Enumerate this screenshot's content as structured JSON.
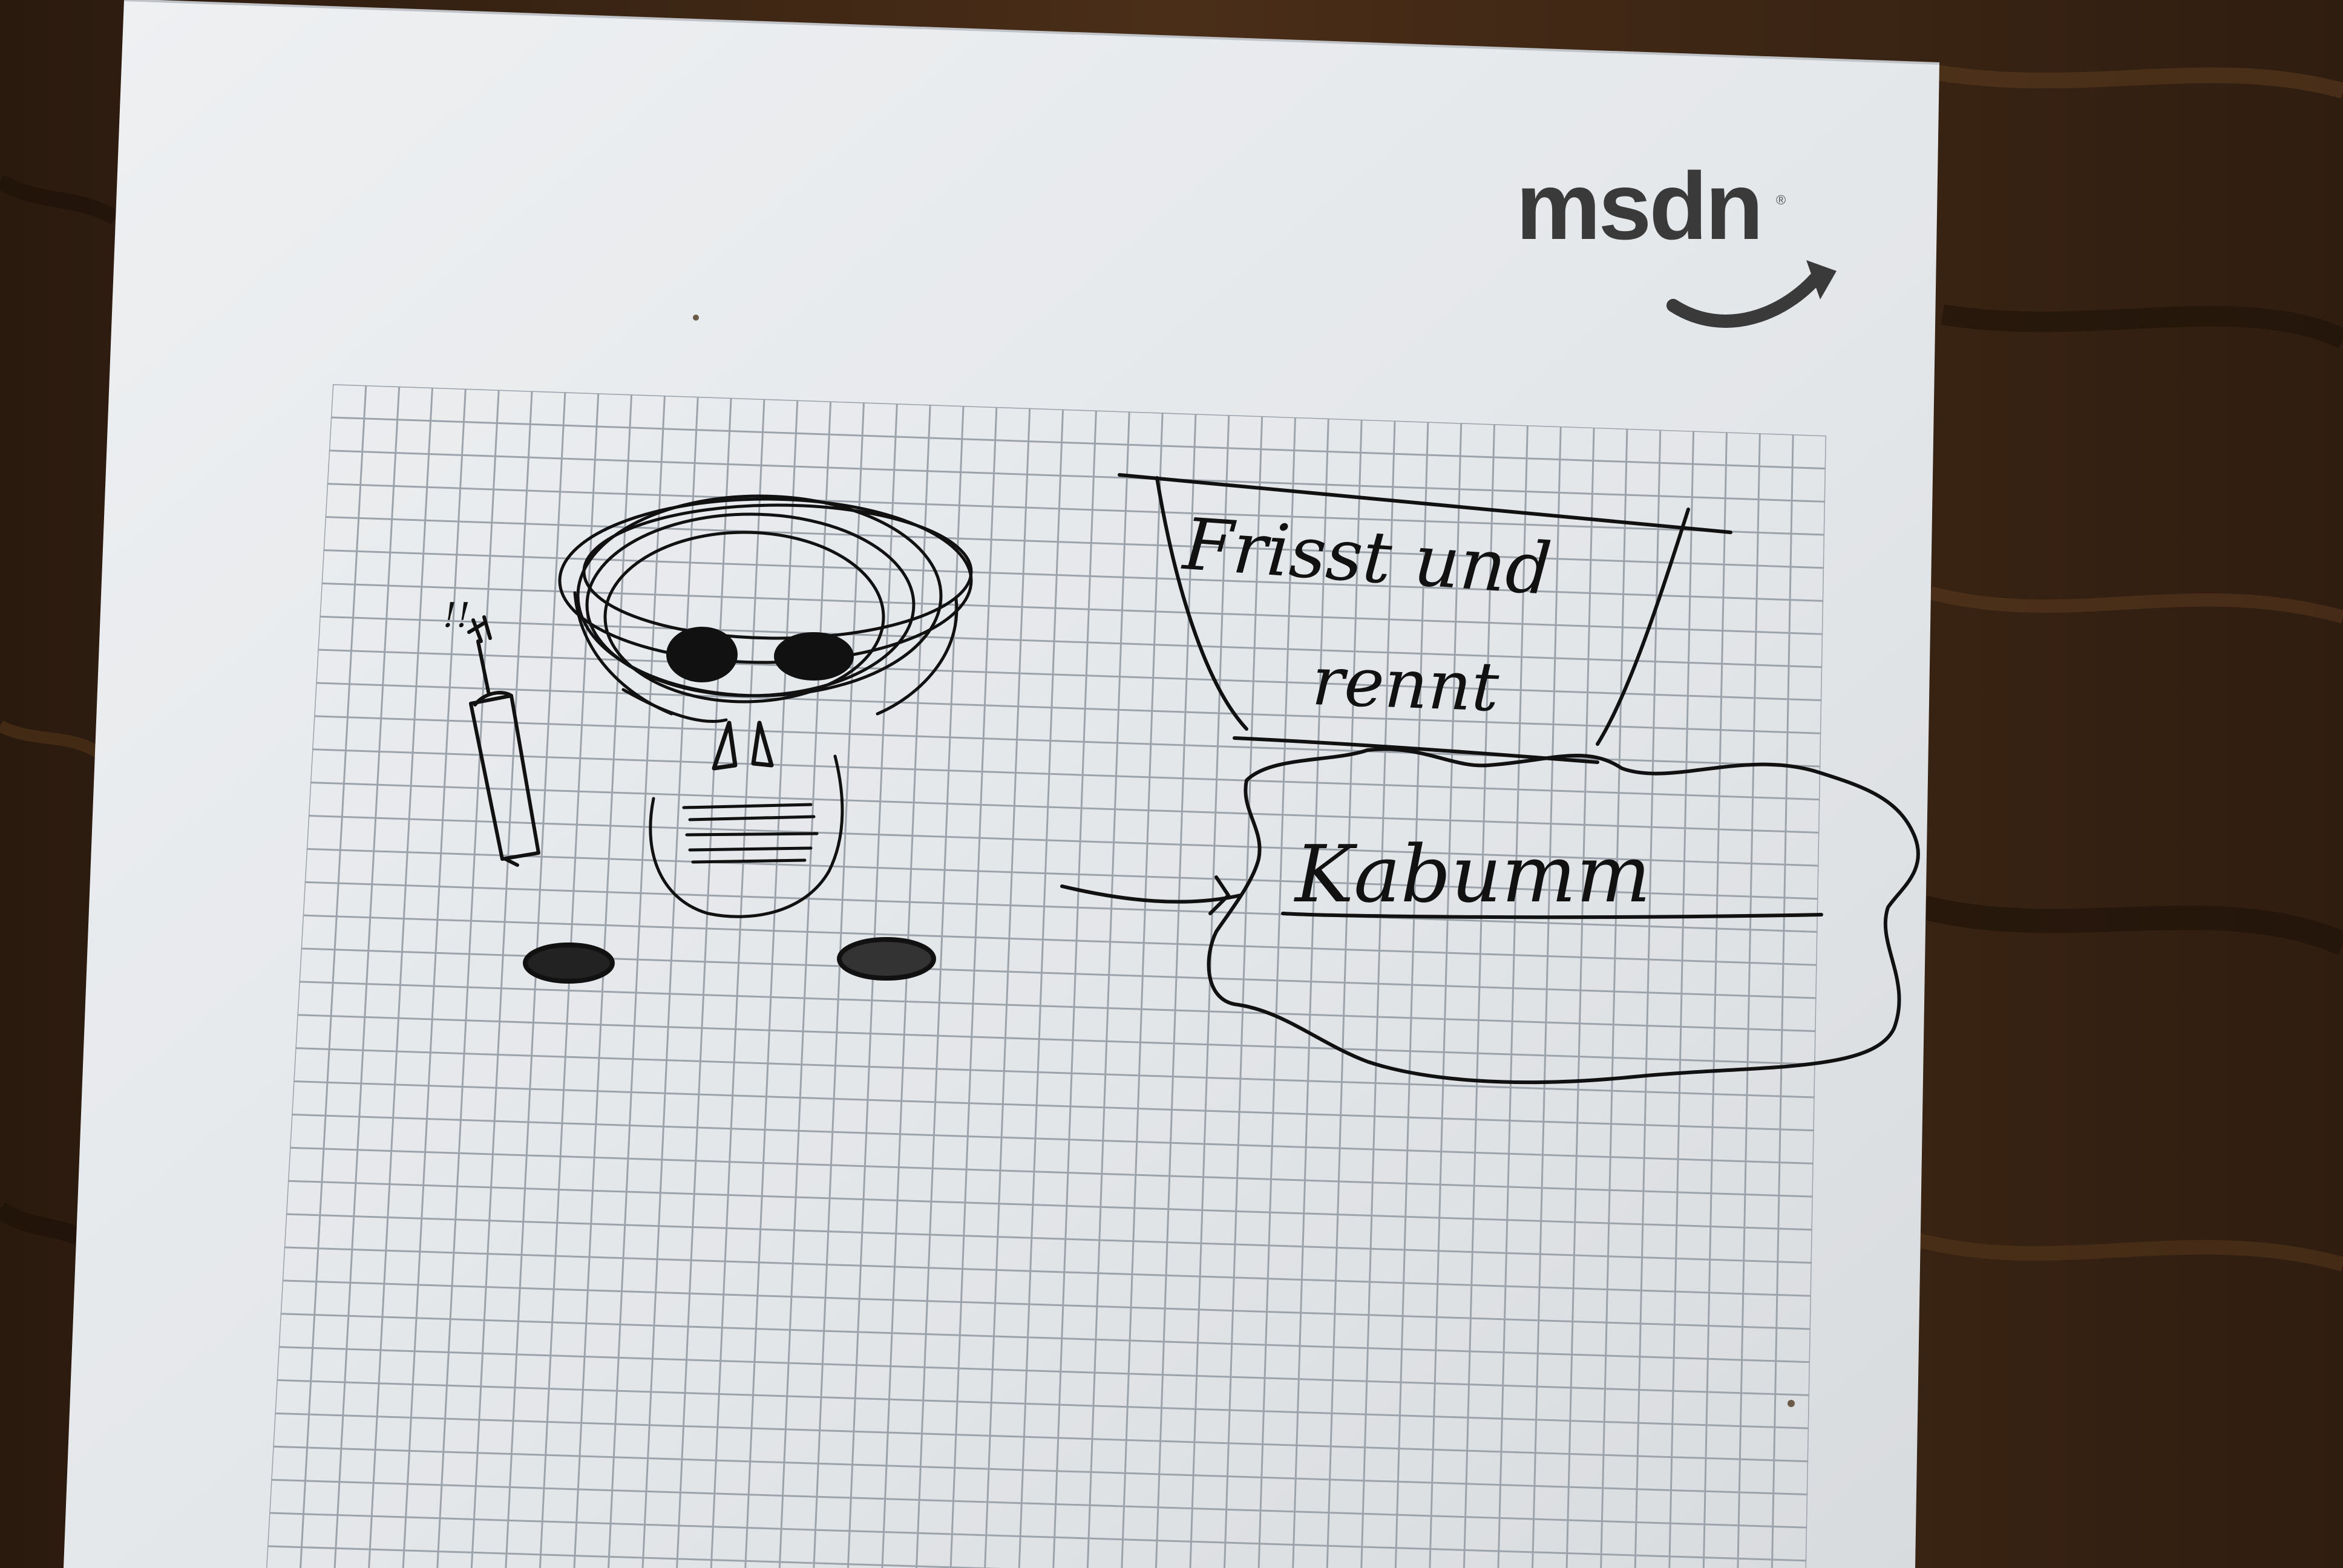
{
  "logo": {
    "text": "msdn",
    "mark": "®"
  },
  "sketch": {
    "warning_mark": "!!",
    "box_text_line1": "Frisst und",
    "box_text_line2": "rennt",
    "cloud_text": "Kabumm"
  },
  "colors": {
    "table_wood": "#3a2414",
    "paper": "#e4e7ea",
    "grid_line": "#9da3aa",
    "pen_ink": "#111111",
    "logo_gray": "#3a3a3a"
  }
}
